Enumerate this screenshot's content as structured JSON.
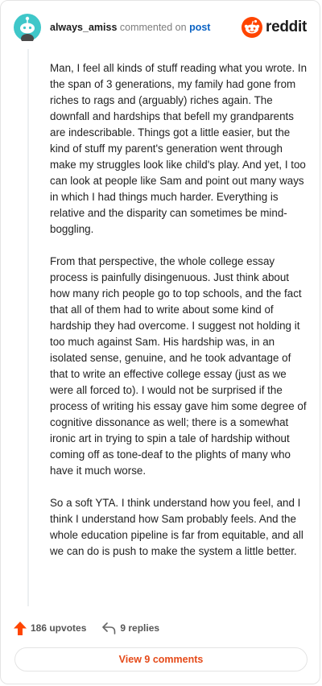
{
  "header": {
    "username": "always_amiss",
    "action_text": "commented on",
    "post_link": "post",
    "brand": "reddit"
  },
  "comment": {
    "paragraphs": [
      "Man, I feel all kinds of stuff reading what you wrote. In the span of 3 generations, my family had gone from riches to rags and (arguably) riches again. The downfall and hardships that befell my grandparents are indescribable. Things got a little easier, but the kind of stuff my parent's generation went through make my struggles look like child's play. And yet, I too can look at people like Sam and point out many ways in which I had things much harder. Everything is relative and the disparity can sometimes be mind-boggling.",
      "From that perspective, the whole college essay process is painfully disingenuous. Just think about how many rich people go to top schools, and the fact that all of them had to write about some kind of hardship they had overcome. I suggest not holding it too much against Sam. His hardship was, in an isolated sense, genuine, and he took advantage of that to write an effective college essay (just as we were all forced to). I would not be surprised if the process of writing his essay gave him some degree of cognitive dissonance as well; there is a somewhat ironic art in trying to spin a tale of hardship without coming off as tone-deaf to the plights of many who have it much worse.",
      "So a soft YTA. I think understand how you feel, and I think I understand how Sam probably feels. And the whole education pipeline is far from equitable, and all we can do is push to make the system a little better."
    ]
  },
  "actions": {
    "upvotes": "186 upvotes",
    "replies": "9 replies"
  },
  "footer": {
    "view_comments": "View 9 comments"
  },
  "colors": {
    "accent": "#ff4500",
    "link": "#0b63c4",
    "button_text": "#e54a19"
  }
}
